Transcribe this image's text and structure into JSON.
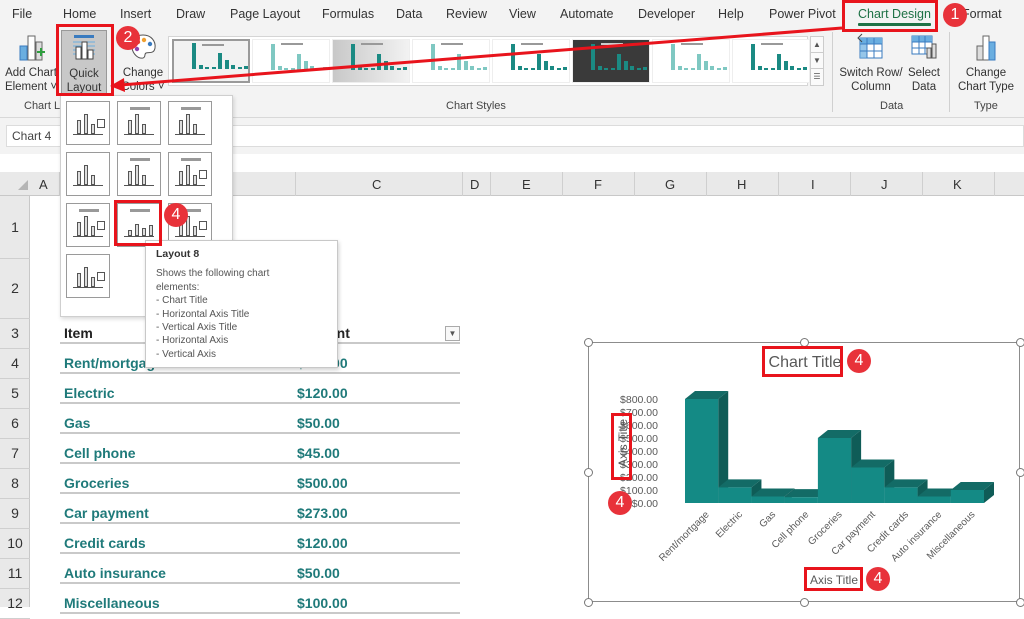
{
  "tabs": [
    "File",
    "Home",
    "Insert",
    "Draw",
    "Page Layout",
    "Formulas",
    "Data",
    "Review",
    "View",
    "Automate",
    "Developer",
    "Help",
    "Power Pivot",
    "Chart Design",
    "Format"
  ],
  "active_tab": "Chart Design",
  "ribbon": {
    "add_chart_element": [
      "Add Chart",
      "Element ˅"
    ],
    "quick_layout": [
      "Quick",
      "Layout ˅"
    ],
    "change_colors": [
      "Change",
      "Colors ˅"
    ],
    "group_chart_layouts": "Chart Layouts",
    "group_chart_styles": "Chart Styles",
    "switch_row_column": [
      "Switch Row/",
      "Column"
    ],
    "select_data": [
      "Select",
      "Data"
    ],
    "group_data": "Data",
    "change_chart_type": [
      "Change",
      "Chart Type"
    ],
    "group_type": "Type",
    "chart_styles_count": 8
  },
  "name_box": "Chart 4",
  "columns": [
    "A",
    "C",
    "D",
    "E",
    "F",
    "G",
    "H",
    "I",
    "J",
    "K"
  ],
  "rows": [
    "1",
    "2",
    "3",
    "4",
    "5",
    "6",
    "7",
    "8",
    "9",
    "10",
    "11",
    "12"
  ],
  "table": {
    "headers": [
      "Item",
      "Amount"
    ],
    "rows": [
      [
        "Rent/mortgage",
        "$800.00"
      ],
      [
        "Electric",
        "$120.00"
      ],
      [
        "Gas",
        "$50.00"
      ],
      [
        "Cell phone",
        "$45.00"
      ],
      [
        "Groceries",
        "$500.00"
      ],
      [
        "Car payment",
        "$273.00"
      ],
      [
        "Credit cards",
        "$120.00"
      ],
      [
        "Auto insurance",
        "$50.00"
      ],
      [
        "Miscellaneous",
        "$100.00"
      ]
    ]
  },
  "quick_layout_menu": {
    "layout_count": 10,
    "highlighted": "Layout 8"
  },
  "tooltip": {
    "title": "Layout 8",
    "intro": "Shows the following chart elements:",
    "items": [
      "- Chart Title",
      "- Horizontal Axis Title",
      "- Vertical Axis Title",
      "- Horizontal Axis",
      "- Vertical Axis"
    ]
  },
  "annotations": {
    "step1": "1",
    "step2": "2",
    "step4": "4"
  },
  "colors": {
    "accent": "#1e7145",
    "bar_front": "#148a85",
    "bar_side": "#0f5c57",
    "bar_top": "#136b66",
    "annotation_red": "#e8141c"
  },
  "chart_data": {
    "type": "bar",
    "title": "Chart Title",
    "xlabel": "Axis Title",
    "ylabel": "Axis Title",
    "categories": [
      "Rent/mortgage",
      "Electric",
      "Gas",
      "Cell phone",
      "Groceries",
      "Car payment",
      "Credit cards",
      "Auto insurance",
      "Miscellaneous"
    ],
    "values": [
      800,
      120,
      50,
      45,
      500,
      273,
      120,
      50,
      100
    ],
    "ylim": [
      0,
      800
    ],
    "yticks": [
      "$0.00",
      "$100.00",
      "$200.00",
      "$300.00",
      "$400.00",
      "$500.00",
      "$600.00",
      "$700.00",
      "$800.00"
    ],
    "style": "3D column",
    "grid": false,
    "legend": "none"
  }
}
